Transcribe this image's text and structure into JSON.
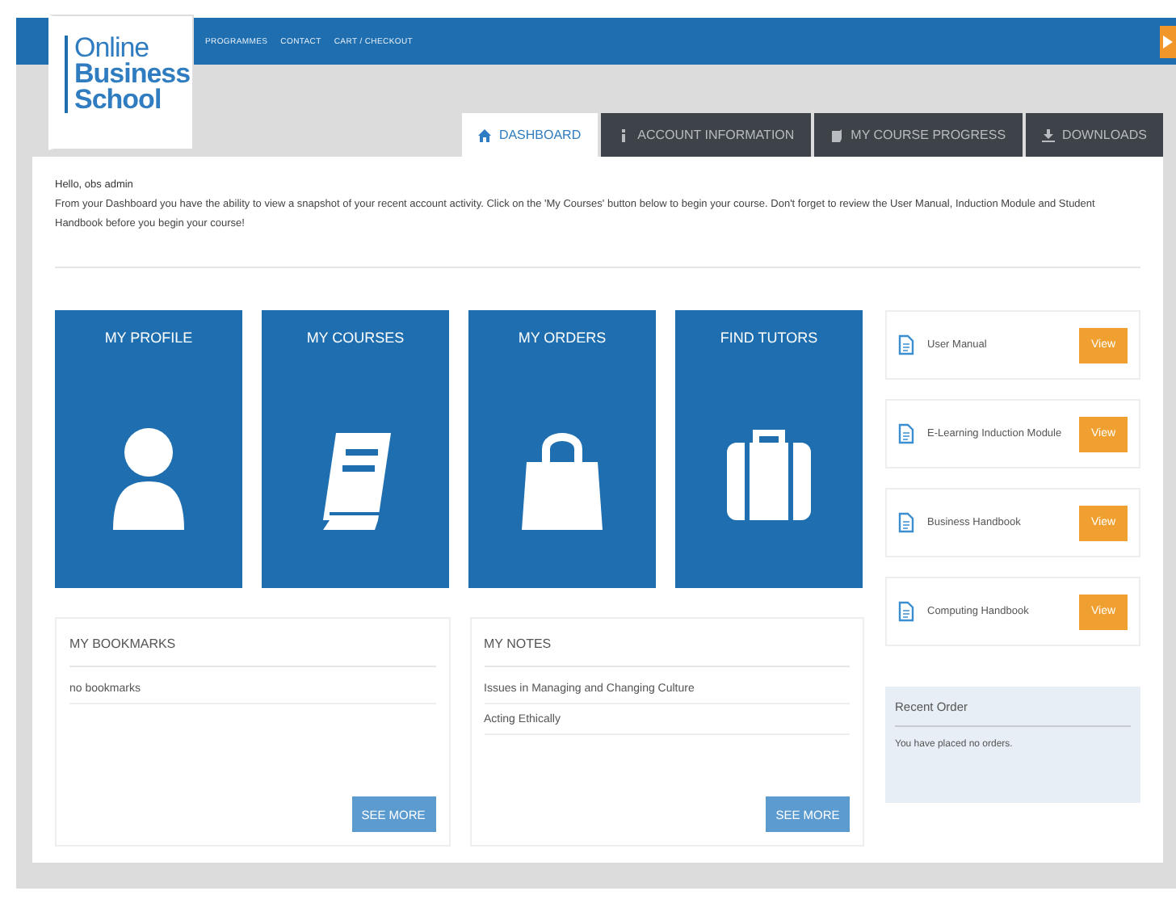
{
  "logo": {
    "lines": [
      "Online",
      "Business",
      "School"
    ]
  },
  "nav_links": [
    "PROGRAMMES",
    "CONTACT",
    "CART / CHECKOUT"
  ],
  "tabs": [
    {
      "label": "DASHBOARD",
      "kind": "home",
      "selected": true
    },
    {
      "label": "ACCOUNT INFORMATION",
      "kind": "info",
      "selected": false
    },
    {
      "label": "MY COURSE PROGRESS",
      "kind": "book",
      "selected": false
    },
    {
      "label": "DOWNLOADS",
      "kind": "download",
      "selected": false
    }
  ],
  "greeting": "Hello, obs admin",
  "intro": "From your Dashboard you have the ability to view a snapshot of your recent account activity. Click on the 'My Courses' button below to begin your course. Don't forget to review the User Manual, Induction Module and Student Handbook before you begin your course!",
  "tiles": [
    {
      "title": "MY PROFILE",
      "kind": "person"
    },
    {
      "title": "MY COURSES",
      "kind": "book"
    },
    {
      "title": "MY ORDERS",
      "kind": "bag"
    },
    {
      "title": "FIND TUTORS",
      "kind": "briefcase"
    }
  ],
  "panels": [
    {
      "title": "MY BOOKMARKS",
      "items": [
        "no bookmarks"
      ],
      "button": "SEE MORE"
    },
    {
      "title": "MY NOTES",
      "items": [
        "Issues in Managing and Changing Culture",
        "Acting Ethically"
      ],
      "button": "SEE MORE"
    }
  ],
  "documents": [
    {
      "name": "User Manual",
      "button": "View"
    },
    {
      "name": "E-Learning Induction Module",
      "button": "View"
    },
    {
      "name": "Business Handbook",
      "button": "View"
    },
    {
      "name": "Computing Handbook",
      "button": "View"
    }
  ],
  "recent_order": {
    "title": "Recent Order",
    "message": "You have placed no orders."
  }
}
